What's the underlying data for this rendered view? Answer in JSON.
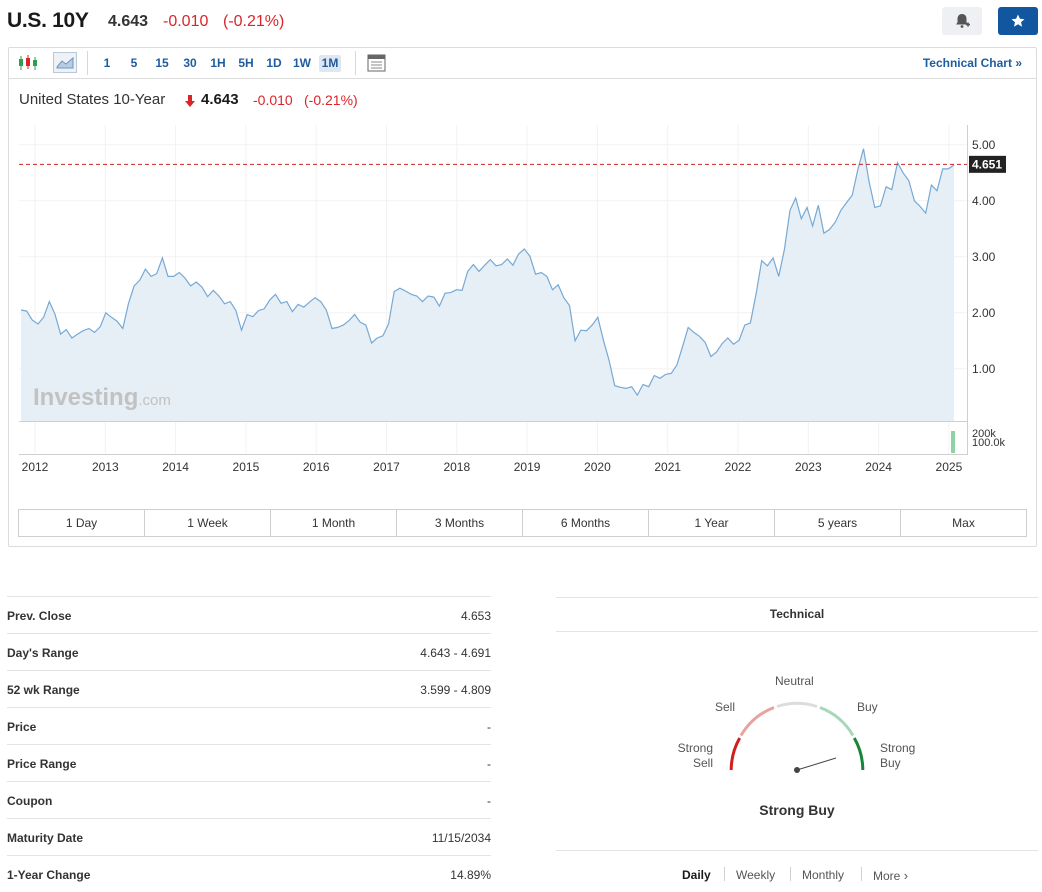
{
  "header": {
    "title": "U.S. 10Y",
    "last": "4.643",
    "change": "-0.010",
    "change_pct": "(-0.21%)"
  },
  "toolbar": {
    "timeframes": [
      "1",
      "5",
      "15",
      "30",
      "1H",
      "5H",
      "1D",
      "1W",
      "1M"
    ],
    "active_timeframe": "1M",
    "technical_chart_label": "Technical Chart",
    "icons": [
      "candlestick-icon",
      "area-chart-icon",
      "layout-icon"
    ]
  },
  "chart": {
    "title": "United States 10-Year",
    "last": "4.643",
    "change": "-0.010",
    "change_pct": "(-0.21%)",
    "current_marker": "4.651",
    "watermark_main": "Investing",
    "watermark_suffix": ".com",
    "volume_labels": [
      "200k",
      "100.0k"
    ]
  },
  "chart_data": {
    "type": "area",
    "ylim": [
      0.0,
      5.5
    ],
    "yticks": [
      "5.00",
      "4.00",
      "3.00",
      "2.00",
      "1.00"
    ],
    "xticks": [
      "2012",
      "2013",
      "2014",
      "2015",
      "2016",
      "2017",
      "2018",
      "2019",
      "2020",
      "2021",
      "2022",
      "2023",
      "2024",
      "2025"
    ],
    "x_start_year": 2011.8,
    "x_end_year": 2025.12,
    "reference_line": 4.651,
    "series": [
      {
        "values": [
          2.05,
          2.03,
          1.87,
          1.8,
          1.92,
          2.2,
          1.98,
          1.62,
          1.7,
          1.55,
          1.62,
          1.68,
          1.72,
          1.65,
          1.75,
          2.0,
          1.92,
          1.85,
          1.72,
          2.16,
          2.48,
          2.58,
          2.78,
          2.65,
          2.7,
          2.98,
          2.65,
          2.65,
          2.72,
          2.62,
          2.48,
          2.55,
          2.46,
          2.29,
          2.4,
          2.3,
          2.16,
          2.2,
          2.04,
          1.69,
          1.97,
          1.93,
          2.04,
          2.07,
          2.23,
          2.33,
          2.17,
          2.2,
          2.02,
          2.15,
          2.1,
          2.19,
          2.27,
          2.2,
          2.05,
          1.72,
          1.74,
          1.78,
          1.86,
          1.97,
          1.83,
          1.78,
          1.46,
          1.55,
          1.59,
          1.8,
          2.38,
          2.44,
          2.39,
          2.33,
          2.3,
          2.2,
          2.3,
          2.28,
          2.12,
          2.35,
          2.36,
          2.41,
          2.4,
          2.74,
          2.86,
          2.74,
          2.85,
          2.95,
          2.84,
          2.86,
          2.96,
          2.85,
          3.05,
          3.14,
          3.01,
          2.69,
          2.72,
          2.65,
          2.41,
          2.5,
          2.27,
          2.13,
          1.5,
          1.69,
          1.68,
          1.78,
          1.92,
          1.51,
          1.15,
          0.7,
          0.67,
          0.65,
          0.68,
          0.53,
          0.72,
          0.68,
          0.88,
          0.83,
          0.9,
          0.92,
          1.07,
          1.4,
          1.74,
          1.65,
          1.58,
          1.47,
          1.22,
          1.3,
          1.45,
          1.55,
          1.44,
          1.51,
          1.78,
          1.82,
          2.34,
          2.93,
          2.84,
          2.98,
          2.65,
          3.13,
          3.83,
          4.05,
          3.68,
          3.88,
          3.55,
          3.92,
          3.42,
          3.49,
          3.62,
          3.83,
          3.97,
          4.1,
          4.56,
          4.93,
          4.33,
          3.88,
          3.91,
          4.25,
          4.2,
          4.68,
          4.5,
          4.36,
          4.0,
          3.9,
          3.78,
          4.28,
          4.18,
          4.57,
          4.57,
          4.64
        ]
      }
    ]
  },
  "ranges": [
    "1 Day",
    "1 Week",
    "1 Month",
    "3 Months",
    "6 Months",
    "1 Year",
    "5 years",
    "Max"
  ],
  "stats": [
    {
      "label": "Prev. Close",
      "value": "4.653"
    },
    {
      "label": "Day's Range",
      "value": "4.643 - 4.691"
    },
    {
      "label": "52 wk Range",
      "value": "3.599 - 4.809"
    },
    {
      "label": "Price",
      "value": "-"
    },
    {
      "label": "Price Range",
      "value": "-"
    },
    {
      "label": "Coupon",
      "value": "-"
    },
    {
      "label": "Maturity Date",
      "value": "11/15/2034"
    },
    {
      "label": "1-Year Change",
      "value": "14.89%"
    }
  ],
  "technical": {
    "title": "Technical",
    "gauge_labels": {
      "neutral": "Neutral",
      "sell": "Sell",
      "buy": "Buy",
      "strong_sell_1": "Strong",
      "strong_sell_2": "Sell",
      "strong_buy_1": "Strong",
      "strong_buy_2": "Buy"
    },
    "summary": "Strong Buy",
    "gauge_colors": {
      "strong_sell": "#d0201c",
      "sell": "#e8a3a0",
      "neutral": "#dcdcdc",
      "buy": "#a6d8b6",
      "strong_buy": "#17853b"
    },
    "periods": [
      "Daily",
      "Weekly",
      "Monthly",
      "More"
    ],
    "active_period": "Daily"
  },
  "colors": {
    "negative": "#d9252a",
    "accent": "#1256a0",
    "line": "#77a9d4",
    "fill": "#e6eef6",
    "reference": "#c9242a",
    "volume": "#8fd3a4"
  }
}
